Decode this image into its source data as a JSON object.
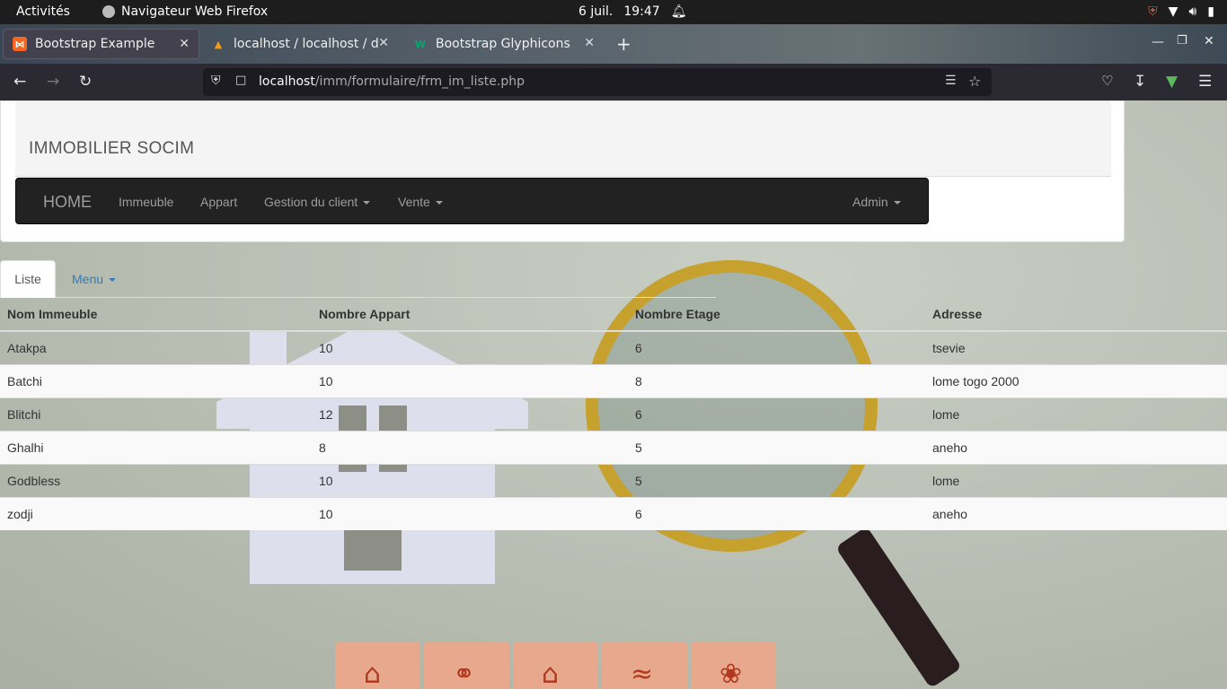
{
  "system_bar": {
    "activities": "Activités",
    "app_name": "Navigateur Web Firefox",
    "date": "6 juil.",
    "time": "19:47"
  },
  "browser": {
    "tabs": [
      {
        "title": "Bootstrap Example"
      },
      {
        "title": "localhost / localhost / db"
      },
      {
        "title": "Bootstrap Glyphicons"
      }
    ],
    "url_host": "localhost",
    "url_path": "/imm/formulaire/frm_im_liste.php"
  },
  "page": {
    "site_title": "IMMOBILIER SOCIM",
    "nav": {
      "home": "HOME",
      "items": [
        "Immeuble",
        "Appart",
        "Gestion du client",
        "Vente"
      ],
      "admin": "Admin"
    },
    "subtabs": {
      "active": "Liste",
      "menu": "Menu"
    },
    "table": {
      "headers": [
        "Nom Immeuble",
        "Nombre Appart",
        "Nombre Etage",
        "Adresse"
      ],
      "rows": [
        [
          "Atakpa",
          "10",
          "6",
          "tsevie"
        ],
        [
          "Batchi",
          "10",
          "8",
          "lome togo 2000"
        ],
        [
          "Blitchi",
          "12",
          "6",
          "lome"
        ],
        [
          "Ghalhi",
          "8",
          "5",
          "aneho"
        ],
        [
          "Godbless",
          "10",
          "5",
          "lome"
        ],
        [
          "zodji",
          "10",
          "6",
          "aneho"
        ]
      ]
    }
  }
}
